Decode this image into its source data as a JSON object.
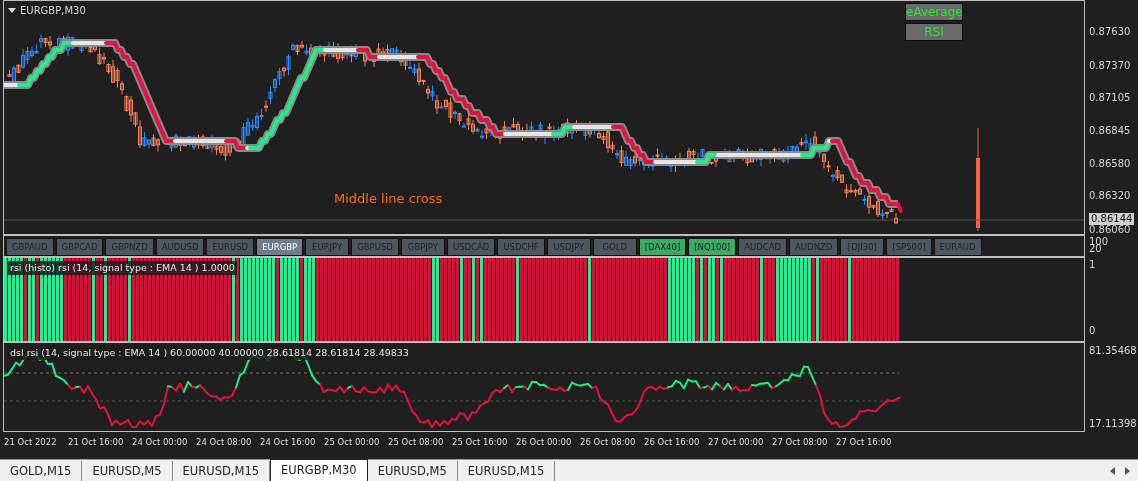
{
  "chart": {
    "title": "EURGBP,M30",
    "annotation": "Middle line cross",
    "panel_buttons": [
      {
        "label": "eAverage"
      },
      {
        "label": "RSI"
      }
    ],
    "price_axis": [
      "0.87630",
      "0.87370",
      "0.87105",
      "0.86845",
      "0.86580",
      "0.86320",
      "0.86060"
    ],
    "current_price": "0.86144"
  },
  "symbol_buttons": [
    {
      "label": "GBPAUD",
      "selected": false,
      "highlighted": false
    },
    {
      "label": "GBPCAD",
      "selected": false,
      "highlighted": false
    },
    {
      "label": "GBPNZD",
      "selected": false,
      "highlighted": false
    },
    {
      "label": "AUDUSD",
      "selected": false,
      "highlighted": false
    },
    {
      "label": "EURUSD",
      "selected": false,
      "highlighted": false
    },
    {
      "label": "EURGBP",
      "selected": true,
      "highlighted": false
    },
    {
      "label": "EURJPY",
      "selected": false,
      "highlighted": false
    },
    {
      "label": "GBPUSD",
      "selected": false,
      "highlighted": false
    },
    {
      "label": "GBPJPY",
      "selected": false,
      "highlighted": false
    },
    {
      "label": "USDCAD",
      "selected": false,
      "highlighted": false
    },
    {
      "label": "USDCHF",
      "selected": false,
      "highlighted": false
    },
    {
      "label": "USDJPY",
      "selected": false,
      "highlighted": false
    },
    {
      "label": "GOLD",
      "selected": false,
      "highlighted": false
    },
    {
      "label": "[DAX40]",
      "selected": false,
      "highlighted": true
    },
    {
      "label": "[NQ100]",
      "selected": false,
      "highlighted": true
    },
    {
      "label": "AUDCAD",
      "selected": false,
      "highlighted": false
    },
    {
      "label": "AUDNZD",
      "selected": false,
      "highlighted": false
    },
    {
      "label": "[DJI30]",
      "selected": false,
      "highlighted": false
    },
    {
      "label": "[SP500]",
      "selected": false,
      "highlighted": false
    },
    {
      "label": "EURAUD",
      "selected": false,
      "highlighted": false
    }
  ],
  "symbol_axis": [
    "100",
    "20"
  ],
  "histogram": {
    "label": "rsi (histo) rsi (14, signal type : EMA  14 ) 1.0000",
    "axis": [
      "1",
      "0"
    ]
  },
  "rsi": {
    "label": "dsl rsi (14, signal type : EMA  14 ) 60.00000 40.00000 28.61814 28.61814 28.49833",
    "axis": [
      "81.35468",
      "17.11398"
    ]
  },
  "time_axis": [
    "21 Oct 2022",
    "21 Oct 16:00",
    "24 Oct 00:00",
    "24 Oct 08:00",
    "24 Oct 16:00",
    "25 Oct 00:00",
    "25 Oct 08:00",
    "25 Oct 16:00",
    "26 Oct 00:00",
    "26 Oct 08:00",
    "26 Oct 16:00",
    "27 Oct 00:00",
    "27 Oct 08:00",
    "27 Oct 16:00"
  ],
  "tabs": [
    {
      "label": "GOLD,M15",
      "selected": false
    },
    {
      "label": "EURUSD,M5",
      "selected": false
    },
    {
      "label": "EURUSD,M15",
      "selected": false
    },
    {
      "label": "EURGBP,M30",
      "selected": true
    },
    {
      "label": "EURUSD,M5",
      "selected": false
    },
    {
      "label": "EURUSD,M15",
      "selected": false
    }
  ]
}
